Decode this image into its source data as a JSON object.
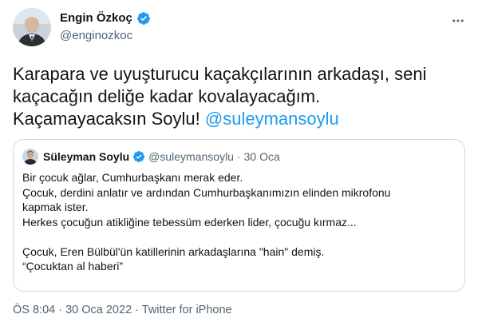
{
  "author": {
    "display_name": "Engin Özkoç",
    "handle": "@enginozkoc",
    "verified_color": "#1d9bf0"
  },
  "tweet": {
    "text_lines": [
      "Karapara ve uyuşturucu kaçakçılarının arkadaşı, seni",
      "kaçacağın deliğe kadar kovalayacağım.",
      "Kaçamayacaksın Soylu! "
    ],
    "mention": "@suleymansoylu",
    "mention_color": "#1d9bf0"
  },
  "quote": {
    "display_name": "Süleyman Soylu",
    "handle": "@suleymansoylu",
    "separator": "·",
    "date": "30 Oca",
    "lines": [
      "Bir çocuk ağlar, Cumhurbaşkanı merak eder.",
      "Çocuk, derdini anlatır ve ardından Cumhurbaşkanımızın elinden mikrofonu",
      "kapmak ister.",
      "Herkes çocuğun atikliğine tebessüm ederken lider, çocuğu kırmaz...",
      "",
      "Çocuk, Eren Bülbül'ün katillerinin arkadaşlarına \"hain\" demiş.",
      "“Çocuktan al haberi”"
    ]
  },
  "meta": {
    "time": "ÖS 8:04",
    "separator1": " · ",
    "date": "30 Oca 2022",
    "separator2": " · ",
    "source": "Twitter for iPhone"
  },
  "icons": {
    "more": "more-icon",
    "verified": "verified-badge-icon"
  }
}
